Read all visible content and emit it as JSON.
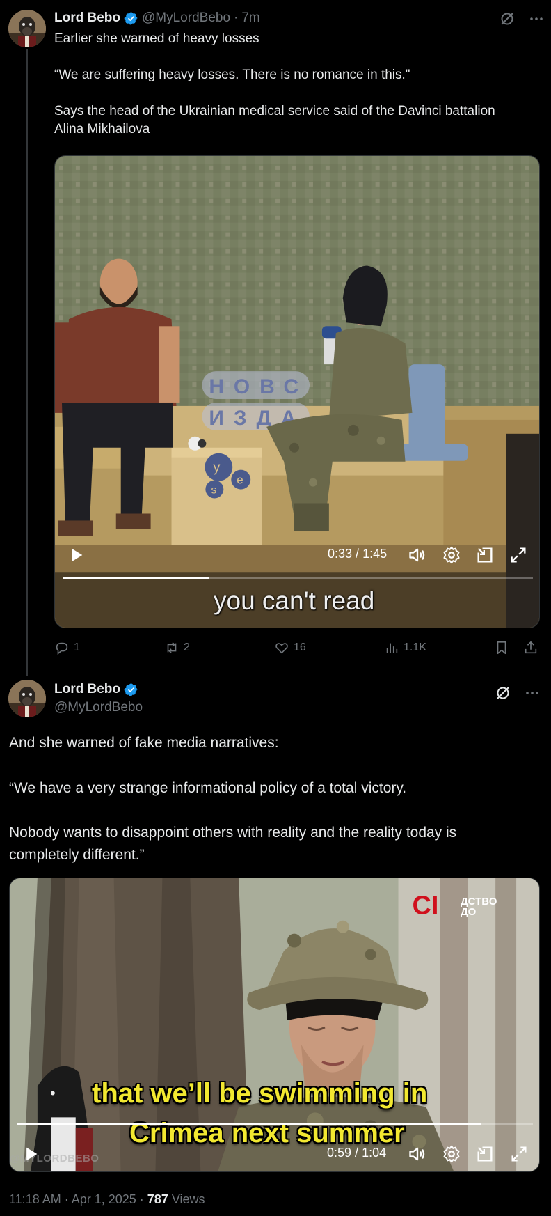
{
  "tweet1": {
    "author_name": "Lord Bebo",
    "handle": "@MyLordBebo",
    "separator": "·",
    "time_ago": "7m",
    "text": "Earlier she warned of heavy losses\n\n“We are suffering heavy losses. There is no romance in this.\"\n\nSays the head of the Ukrainian medical service said of the Davinci battalion\nAlina Mikhailova",
    "video": {
      "subtitle": "you can't read",
      "elapsed": "0:33",
      "duration": "1:45",
      "time_separator": " / ",
      "progress": 0.31,
      "sign_letters_row1": "НОВС",
      "sign_letters_row2": "ИЗДА",
      "table_logo_letters": [
        "y",
        "e",
        "s"
      ]
    },
    "actions": {
      "replies": "1",
      "reposts": "2",
      "likes": "16",
      "views": "1.1K"
    }
  },
  "tweet2": {
    "author_name": "Lord Bebo",
    "handle": "@MyLordBebo",
    "text": "And she warned of fake media narratives:\n\n“We have a very strange informational policy of a total victory.\n\nNobody wants to disappoint others with reality and the reality today is\ncompletely different.”",
    "video": {
      "subtitle_line1": "that we’ll be swimming in",
      "subtitle_line2": "Crimea next summer",
      "elapsed": "0:59",
      "duration": "1:04",
      "time_separator": " / ",
      "progress": 0.9,
      "channel_logo_mark": "CI",
      "channel_logo_text_line1": "ДСТВО",
      "channel_logo_text_line2": "ДО",
      "watermark": "@MYLORDBEBO"
    },
    "timestamp": "11:18 AM · Apr 1, 2025 · ",
    "views_count": "787",
    "views_label": " Views"
  },
  "colors": {
    "background": "#000000",
    "text_primary": "#e7e9ea",
    "text_secondary": "#71767b",
    "verified_blue": "#1d9bf0",
    "subtitle_yellow": "#f2e830"
  },
  "icons": [
    "verified-badge-icon",
    "grok-icon",
    "more-icon",
    "play-icon",
    "volume-icon",
    "settings-icon",
    "pip-icon",
    "fullscreen-icon",
    "reply-icon",
    "repost-icon",
    "like-icon",
    "views-icon",
    "bookmark-icon",
    "share-icon"
  ]
}
